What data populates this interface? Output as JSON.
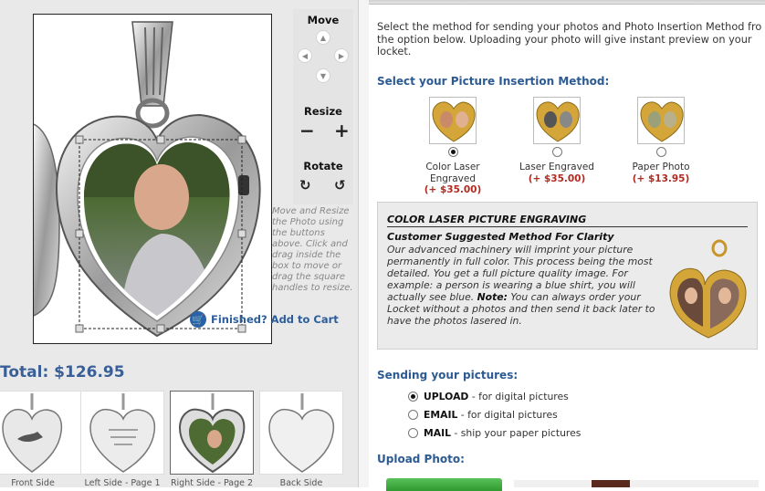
{
  "editor": {
    "move_label": "Move",
    "resize_label": "Resize",
    "rotate_label": "Rotate",
    "help_text": "Move and Resize the Photo using the buttons above. Click and drag inside the box to move or drag the square handles to resize.",
    "finish_label": "Finished? Add to Cart"
  },
  "total": "Total: $126.95",
  "thumbnails": [
    {
      "label": "Front Side"
    },
    {
      "label": "Left Side - Page 1"
    },
    {
      "label": "Right Side - Page 2"
    },
    {
      "label": "Back Side"
    }
  ],
  "intro_text": "Select the method for sending your photos and Photo Insertion Method fro the option below. Uploading your photo will give instant preview on your locket.",
  "insertion": {
    "heading": "Select your Picture Insertion Method:",
    "methods": [
      {
        "name": "Color Laser Engraved",
        "price": "(+ $35.00)",
        "selected": true
      },
      {
        "name": "Laser Engraved",
        "price": "(+ $35.00)",
        "selected": false
      },
      {
        "name": "Paper Photo",
        "price": "(+ $13.95)",
        "selected": false
      }
    ]
  },
  "engraving_box": {
    "title": "COLOR LASER PICTURE ENGRAVING",
    "subtitle": "Customer Suggested Method For Clarity",
    "body": "Our advanced machinery will imprint your picture permanently in full color. This process being the most detailed. You get a full picture quality image. For example: a person is wearing a blue shirt, you will actually see blue.",
    "note_label": "Note:",
    "note_text": " You can always order your Locket without a photos and then send it back later to have the photos lasered in."
  },
  "sending": {
    "heading": "Sending your pictures:",
    "options": [
      {
        "key": "UPLOAD",
        "desc": " - for digital pictures",
        "selected": true
      },
      {
        "key": "EMAIL",
        "desc": " - for digital pictures",
        "selected": false
      },
      {
        "key": "MAIL",
        "desc": " - ship your paper pictures",
        "selected": false
      }
    ]
  },
  "upload": {
    "heading": "Upload Photo:"
  },
  "colors": {
    "heading_blue": "#2c5a92",
    "price_red": "#b02a1f",
    "total_blue": "#3a5f97",
    "gold": "#d4a63a"
  }
}
